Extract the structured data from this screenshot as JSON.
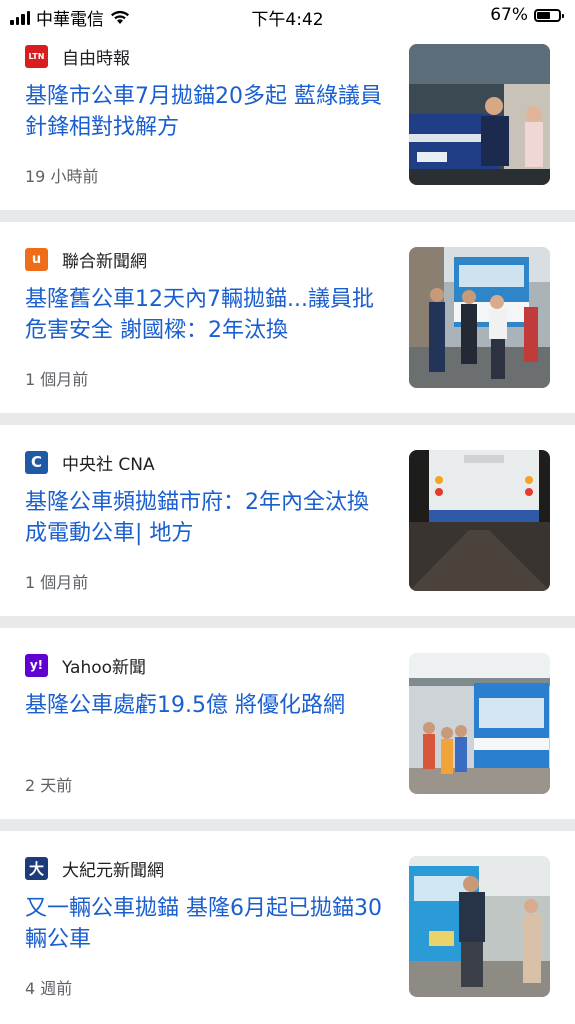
{
  "status_bar": {
    "carrier": "中華電信",
    "time": "下午4:42",
    "battery_percent": "67%",
    "battery_level": 0.67,
    "icons": [
      "signal-icon",
      "wifi-icon",
      "battery-icon"
    ]
  },
  "articles": [
    {
      "source": "自由時報",
      "logo_text": "LTN",
      "logo_color": "#d81e1e",
      "title": "基隆市公車7月拋錨20多起 藍綠議員針鋒相對找解方",
      "time": "19 小時前"
    },
    {
      "source": "聯合新聞網",
      "logo_text": "u",
      "logo_color": "#ef6c1a",
      "title": "基隆舊公車12天內7輛拋錨...議員批危害安全 謝國樑：2年汰換",
      "time": "1 個月前"
    },
    {
      "source": "中央社 CNA",
      "logo_text": "C",
      "logo_color": "#1f5aa6",
      "title": "基隆公車頻拋錨市府：2年內全汰換成電動公車| 地方",
      "time": "1 個月前"
    },
    {
      "source": "Yahoo新聞",
      "logo_text": "y!",
      "logo_color": "#6001d2",
      "title": "基隆公車處虧19.5億 將優化路網",
      "time": "2 天前"
    },
    {
      "source": "大紀元新聞網",
      "logo_text": "大",
      "logo_color": "#1d3b7a",
      "title": "又一輛公車拋錨 基隆6月起已拋錨30輛公車",
      "time": "4 週前"
    }
  ]
}
